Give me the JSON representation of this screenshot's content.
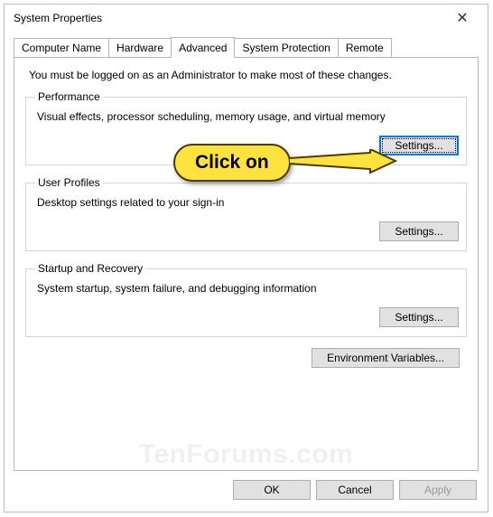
{
  "window": {
    "title": "System Properties"
  },
  "tabs": {
    "computer_name": "Computer Name",
    "hardware": "Hardware",
    "advanced": "Advanced",
    "system_protection": "System Protection",
    "remote": "Remote"
  },
  "intro": "You must be logged on as an Administrator to make most of these changes.",
  "groups": {
    "performance": {
      "legend": "Performance",
      "desc": "Visual effects, processor scheduling, memory usage, and virtual memory",
      "button": "Settings..."
    },
    "user_profiles": {
      "legend": "User Profiles",
      "desc": "Desktop settings related to your sign-in",
      "button": "Settings..."
    },
    "startup": {
      "legend": "Startup and Recovery",
      "desc": "System startup, system failure, and debugging information",
      "button": "Settings..."
    }
  },
  "env_button": "Environment Variables...",
  "footer": {
    "ok": "OK",
    "cancel": "Cancel",
    "apply": "Apply"
  },
  "callout": "Click on",
  "watermark": "TenForums.com"
}
